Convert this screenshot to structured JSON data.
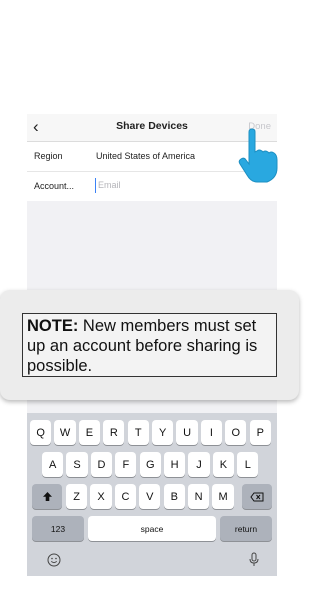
{
  "nav": {
    "back_icon": "chevron-left-icon",
    "back_glyph": "‹",
    "title": "Share Devices",
    "done_label": "Done"
  },
  "form": {
    "region_label": "Region",
    "region_value": "United States of America",
    "account_label": "Account...",
    "account_placeholder": "Email",
    "account_value": ""
  },
  "note": {
    "heading": "NOTE:",
    "text": " New members must set up an account before sharing is possible."
  },
  "keyboard": {
    "row1": [
      "Q",
      "W",
      "E",
      "R",
      "T",
      "Y",
      "U",
      "I",
      "O",
      "P"
    ],
    "row2": [
      "A",
      "S",
      "D",
      "F",
      "G",
      "H",
      "J",
      "K",
      "L"
    ],
    "row3": [
      "Z",
      "X",
      "C",
      "V",
      "B",
      "N",
      "M"
    ],
    "shift_icon": "shift-icon",
    "backspace_icon": "backspace-icon",
    "numbers_label": "123",
    "space_label": "space",
    "return_label": "return",
    "emoji_icon": "emoji-icon",
    "mic_icon": "microphone-icon"
  },
  "colors": {
    "accent": "#3b82f6",
    "hand": "#29a8e0",
    "done_disabled": "#c7c7cc"
  }
}
